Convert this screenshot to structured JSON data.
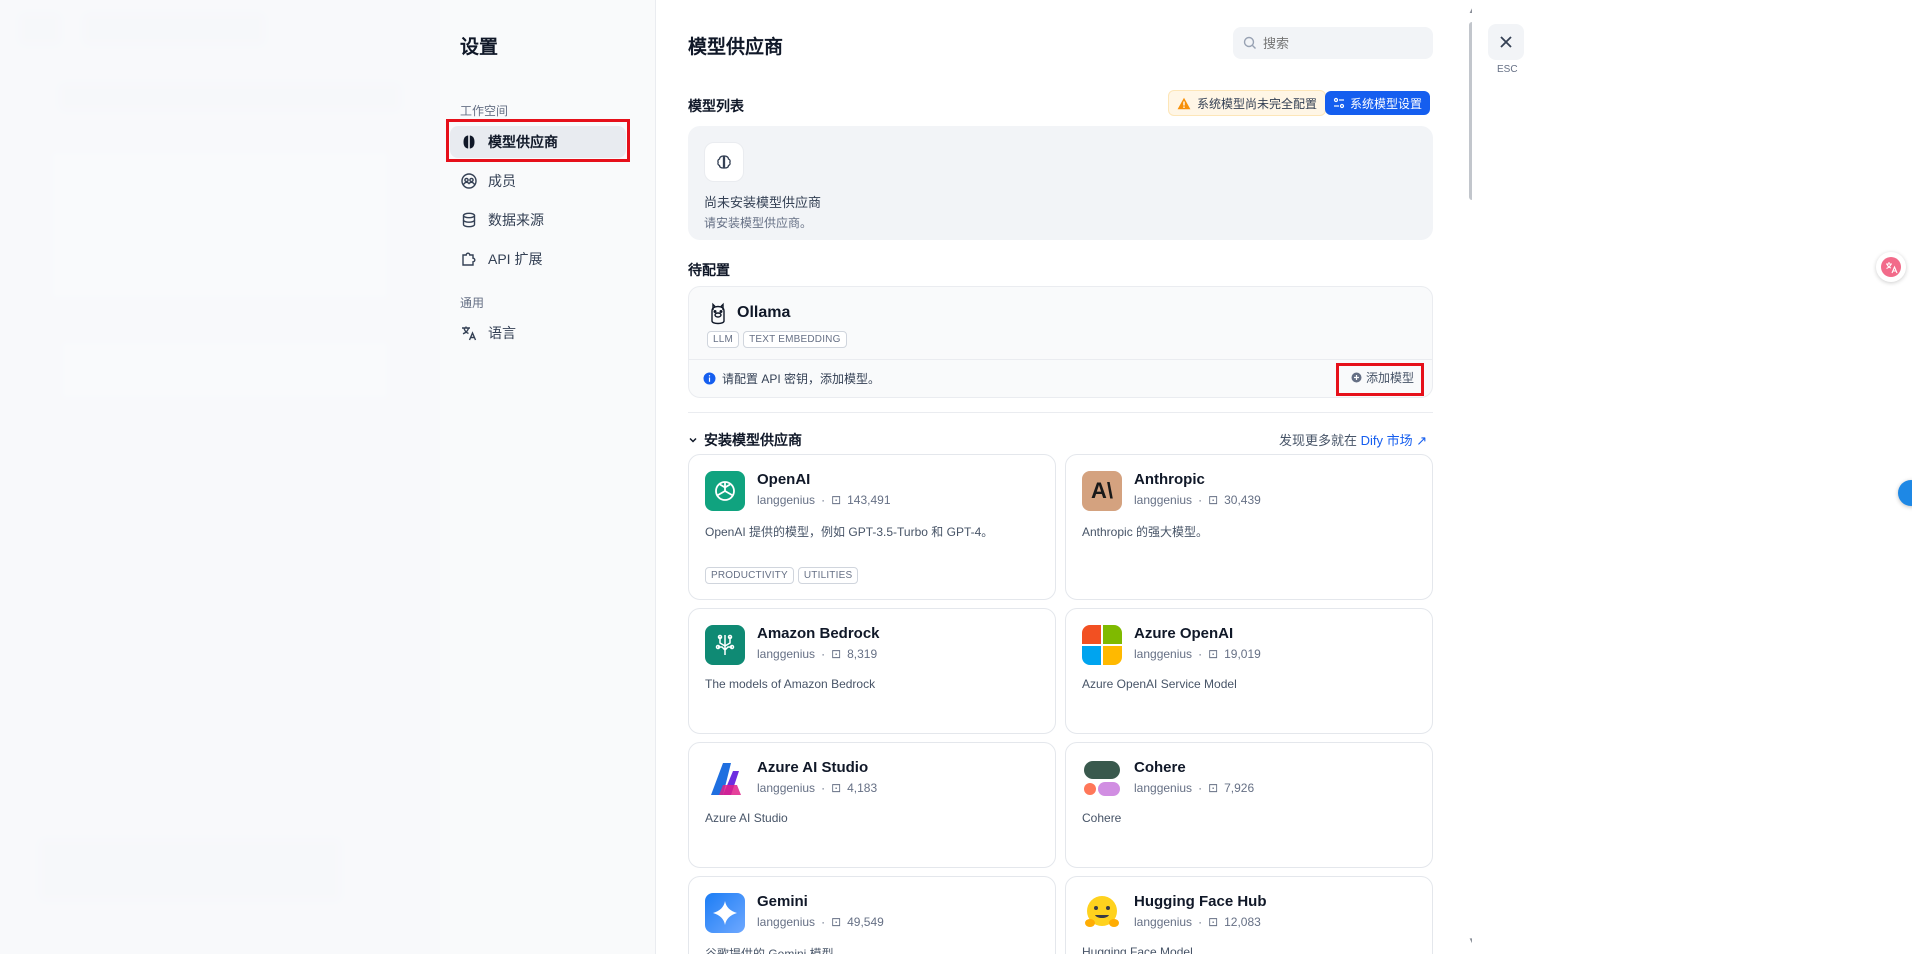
{
  "sidebar": {
    "title": "设置",
    "workspace_label": "工作空间",
    "general_label": "通用",
    "items": [
      {
        "label": "模型供应商"
      },
      {
        "label": "成员"
      },
      {
        "label": "数据来源"
      },
      {
        "label": "API 扩展"
      },
      {
        "label": "语言"
      }
    ]
  },
  "main": {
    "title": "模型供应商",
    "search_placeholder": "搜索",
    "model_list_title": "模型列表",
    "warning_text": "系统模型尚未完全配置",
    "system_model_button": "系统模型设置",
    "empty_title": "尚未安装模型供应商",
    "empty_desc": "请安装模型供应商。",
    "pending_title": "待配置",
    "pending": {
      "name": "Ollama",
      "tags": [
        "LLM",
        "TEXT EMBEDDING"
      ],
      "note": "请配置 API 密钥，添加模型。",
      "add_button": "添加模型"
    },
    "install_title": "安装模型供应商",
    "market_prefix": "发现更多就在",
    "market_link": "Dify 市场 ↗",
    "providers": [
      {
        "name": "OpenAI",
        "author": "langgenius",
        "downloads": "143,491",
        "desc": "OpenAI 提供的模型，例如 GPT-3.5-Turbo 和 GPT-4。",
        "tags": [
          "PRODUCTIVITY",
          "UTILITIES"
        ]
      },
      {
        "name": "Anthropic",
        "author": "langgenius",
        "downloads": "30,439",
        "desc": "Anthropic 的强大模型。"
      },
      {
        "name": "Amazon Bedrock",
        "author": "langgenius",
        "downloads": "8,319",
        "desc": "The models of Amazon Bedrock"
      },
      {
        "name": "Azure OpenAI",
        "author": "langgenius",
        "downloads": "19,019",
        "desc": "Azure OpenAI Service Model"
      },
      {
        "name": "Azure AI Studio",
        "author": "langgenius",
        "downloads": "4,183",
        "desc": "Azure AI Studio"
      },
      {
        "name": "Cohere",
        "author": "langgenius",
        "downloads": "7,926",
        "desc": "Cohere"
      },
      {
        "name": "Gemini",
        "author": "langgenius",
        "downloads": "49,549",
        "desc": "谷歌提供的 Gemini 模型"
      },
      {
        "name": "Hugging Face Hub",
        "author": "langgenius",
        "downloads": "12,083",
        "desc": "Hugging Face Model"
      }
    ]
  },
  "close": {
    "esc_label": "ESC"
  },
  "colors": {
    "accent": "#155eef",
    "highlight": "#e6101a",
    "warning": "#f79009"
  }
}
